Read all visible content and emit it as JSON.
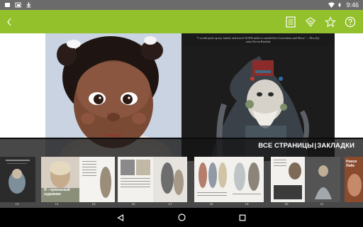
{
  "status_bar": {
    "time": "9:46"
  },
  "app_bar": {
    "accent_color": "#92c12b",
    "actions": [
      "back-icon",
      "contents-icon",
      "edit-icon",
      "bookmark-star-icon",
      "help-icon"
    ]
  },
  "page_right": {
    "quote": "\"I would pack up my family and travel 10,000 miles to attend this Convention and Show.\" – Elsa (by artist Kevin Burdin)"
  },
  "thumb_strip": {
    "tab_all_pages": "ВСЕ СТРАНИЦЫ",
    "tab_separator": "|",
    "tab_bookmarks": "ЗАКЛАДКИ",
    "page_numbers": [
      "13",
      "14",
      "15",
      "16",
      "17",
      "18",
      "19",
      "20",
      "21"
    ],
    "thumb_title": "Я – кукольный художник",
    "thumb_title_right": "Нэнси Лейк"
  },
  "nav_bar": {
    "buttons": [
      "back-triangle-icon",
      "home-circle-icon",
      "recents-square-icon"
    ]
  }
}
